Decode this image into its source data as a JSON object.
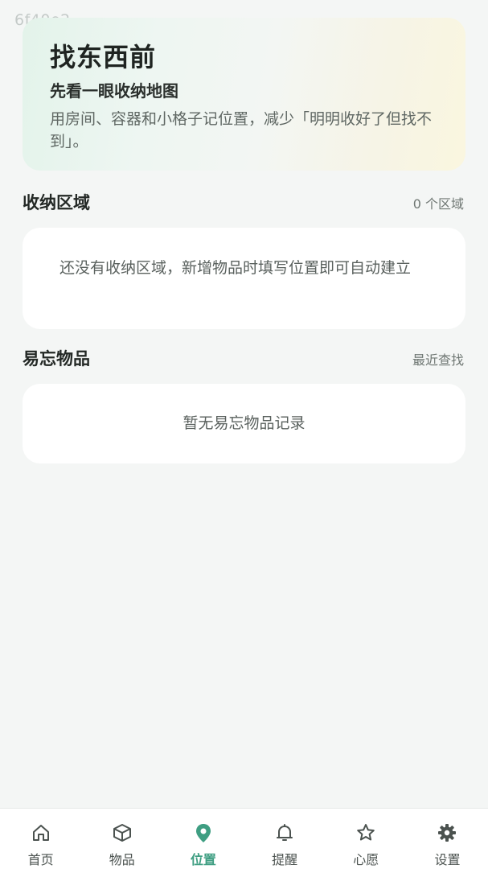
{
  "watermark": "6f40e2",
  "hero": {
    "title": "找东西前",
    "subtitle": "先看一眼收纳地图",
    "description": "用房间、容器和小格子记位置，减少「明明收好了但找不到」。"
  },
  "storage": {
    "title": "收纳区域",
    "count": "0 个区域",
    "empty": "还没有收纳区域，新增物品时填写位置即可自动建立"
  },
  "forgettable": {
    "title": "易忘物品",
    "meta": "最近查找",
    "empty": "暂无易忘物品记录"
  },
  "tabs": [
    {
      "label": "首页",
      "icon": "home-icon",
      "active": false
    },
    {
      "label": "物品",
      "icon": "box-icon",
      "active": false
    },
    {
      "label": "位置",
      "icon": "location-pin-icon",
      "active": true
    },
    {
      "label": "提醒",
      "icon": "bell-icon",
      "active": false
    },
    {
      "label": "心愿",
      "icon": "star-icon",
      "active": false
    },
    {
      "label": "设置",
      "icon": "gear-icon",
      "active": false
    }
  ],
  "colors": {
    "accent": "#3f9e82",
    "background": "#f4f6f5",
    "card": "#ffffff"
  }
}
